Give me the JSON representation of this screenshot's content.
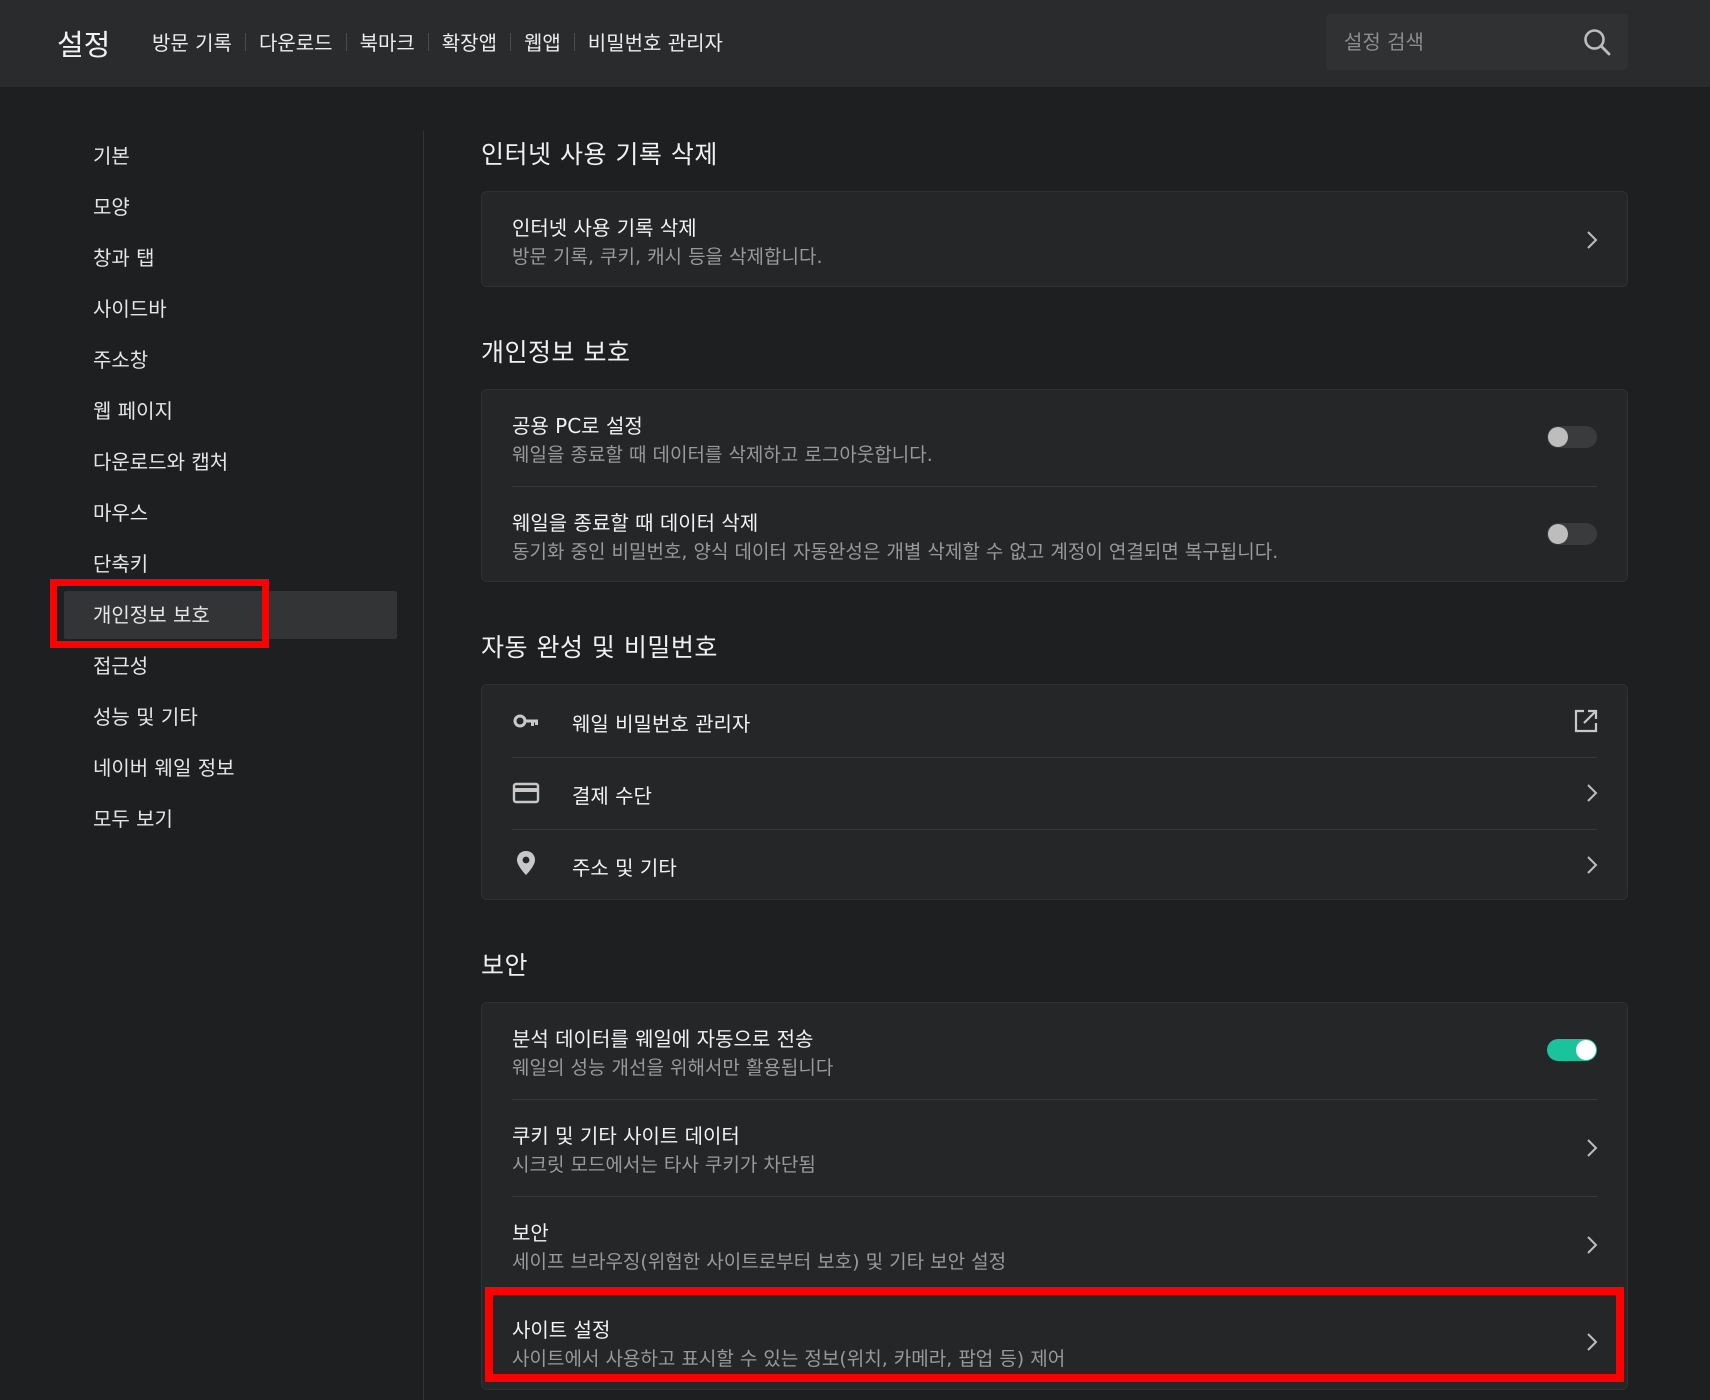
{
  "header": {
    "title": "설정",
    "nav": [
      "방문 기록",
      "다운로드",
      "북마크",
      "확장앱",
      "웹앱",
      "비밀번호 관리자"
    ],
    "search_placeholder": "설정 검색"
  },
  "sidebar": {
    "items": [
      {
        "label": "기본"
      },
      {
        "label": "모양"
      },
      {
        "label": "창과 탭"
      },
      {
        "label": "사이드바"
      },
      {
        "label": "주소창"
      },
      {
        "label": "웹 페이지"
      },
      {
        "label": "다운로드와 캡처"
      },
      {
        "label": "마우스"
      },
      {
        "label": "단축키"
      },
      {
        "label": "개인정보 보호",
        "active": true
      },
      {
        "label": "접근성"
      },
      {
        "label": "성능 및 기타"
      },
      {
        "label": "네이버 웨일 정보"
      },
      {
        "label": "모두 보기"
      }
    ]
  },
  "sections": {
    "clear_history": {
      "title": "인터넷 사용 기록 삭제",
      "row": {
        "title": "인터넷 사용 기록 삭제",
        "sub": "방문 기록, 쿠키, 캐시 등을 삭제합니다."
      }
    },
    "privacy": {
      "title": "개인정보 보호",
      "public_pc": {
        "title": "공용 PC로 설정",
        "sub": "웨일을 종료할 때 데이터를 삭제하고 로그아웃합니다.",
        "enabled": false
      },
      "clear_on_exit": {
        "title": "웨일을 종료할 때 데이터 삭제",
        "sub": "동기화 중인 비밀번호, 양식 데이터 자동완성은 개별 삭제할 수 없고 계정이 연결되면 복구됩니다.",
        "enabled": false
      }
    },
    "autofill": {
      "title": "자동 완성 및 비밀번호",
      "password_manager": {
        "label": "웨일 비밀번호 관리자",
        "icon": "key-icon"
      },
      "payment": {
        "label": "결제 수단",
        "icon": "credit-card-icon"
      },
      "address": {
        "label": "주소 및 기타",
        "icon": "location-pin-icon"
      }
    },
    "security": {
      "title": "보안",
      "analytics": {
        "title": "분석 데이터를 웨일에 자동으로 전송",
        "sub": "웨일의 성능 개선을 위해서만 활용됩니다",
        "enabled": true
      },
      "cookies": {
        "title": "쿠키 및 기타 사이트 데이터",
        "sub": "시크릿 모드에서는 타사 쿠키가 차단됨"
      },
      "security_row": {
        "title": "보안",
        "sub": "세이프 브라우징(위험한 사이트로부터 보호) 및 기타 보안 설정"
      },
      "site_settings": {
        "title": "사이트 설정",
        "sub": "사이트에서 사용하고 표시할 수 있는 정보(위치, 카메라, 팝업 등) 제어"
      }
    }
  },
  "colors": {
    "accent": "#19c39b",
    "highlight": "#ff0000",
    "background": "#1e1f21"
  }
}
